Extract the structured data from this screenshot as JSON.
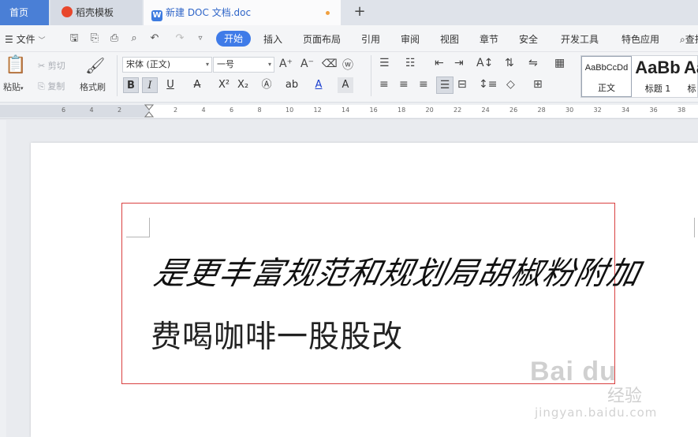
{
  "tabs": {
    "home": "首页",
    "template": "稻壳模板",
    "document": "新建 DOC 文档.doc",
    "add": "+"
  },
  "menu": {
    "file": "文件",
    "items": [
      "开始",
      "插入",
      "页面布局",
      "引用",
      "审阅",
      "视图",
      "章节",
      "安全",
      "开发工具",
      "特色应用"
    ],
    "search": "查找"
  },
  "ribbon": {
    "paste": "粘贴",
    "cut": "剪切",
    "copy": "复制",
    "format_painter": "格式刷",
    "font_name": "宋体 (正文)",
    "font_size": "一号",
    "styles": [
      {
        "sample": "AaBbCcDd",
        "label": "正文"
      },
      {
        "sample": "AaBb",
        "label": "标题 1"
      },
      {
        "sample": "Aa",
        "label": "标"
      }
    ]
  },
  "ruler": {
    "ticks": [
      "6",
      "4",
      "2",
      "2",
      "4",
      "6",
      "8",
      "10",
      "12",
      "14",
      "16",
      "18",
      "20",
      "22",
      "24",
      "26",
      "28",
      "30",
      "32",
      "34",
      "36",
      "38"
    ]
  },
  "document": {
    "line1": "是更丰富规范和规划局胡椒粉附加",
    "line2": "费喝咖啡一股股改"
  },
  "watermark": {
    "logo": "Bai du",
    "text": "经验",
    "url": "jingyan.baidu.com"
  },
  "colors": {
    "accent": "#3f7be8",
    "home_tab": "#4a7fd6",
    "frame": "#d94040"
  }
}
